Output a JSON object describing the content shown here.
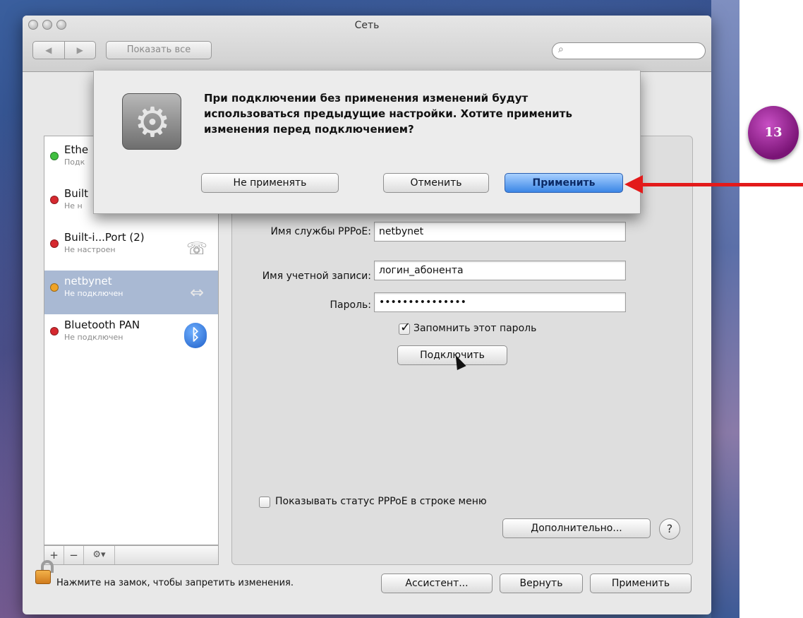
{
  "window": {
    "title": "Сеть",
    "nav": {
      "back_glyph": "◀",
      "forward_glyph": "▶"
    },
    "show_all_label": "Показать все",
    "search": {
      "icon": "magnifier-icon",
      "glyph": "⌕",
      "placeholder": ""
    }
  },
  "sidebar": {
    "items": [
      {
        "name": "Ethe",
        "status": "Подк",
        "dot_color": "#3fbf3f",
        "icon": "ethernet-icon",
        "selected": false
      },
      {
        "name": "Built",
        "status": "Не н",
        "dot_color": "#d6282f",
        "icon": "modem-icon",
        "selected": false
      },
      {
        "name": "Built-i...Port (2)",
        "status": "Не настроен",
        "dot_color": "#d6282f",
        "icon": "phone-icon",
        "selected": false
      },
      {
        "name": "netbynet",
        "status": "Не подключен",
        "dot_color": "#f0a326",
        "icon": "pppoe-arrows-icon",
        "selected": true
      },
      {
        "name": "Bluetooth PAN",
        "status": "Не подключен",
        "dot_color": "#d6282f",
        "icon": "bluetooth-icon",
        "selected": false
      }
    ],
    "add_label": "+",
    "remove_label": "−",
    "gear_label": "⚙▾"
  },
  "form": {
    "service_label": "Имя службы PPPoE:",
    "service_value": "netbynet",
    "account_label": "Имя учетной записи:",
    "account_value": "логин_абонента",
    "password_label": "Пароль:",
    "password_value": "•••••••••••••••",
    "remember_label": "Запомнить этот пароль",
    "remember_checked": true,
    "connect_label": "Подключить",
    "show_status_label": "Показывать статус PPPoE в строке меню",
    "show_status_checked": false,
    "advanced_label": "Дополнительно...",
    "help_label": "?"
  },
  "footer": {
    "lock_text": "Нажмите на замок, чтобы запретить изменения.",
    "assistant_label": "Ассистент...",
    "revert_label": "Вернуть",
    "apply_label": "Применить"
  },
  "sheet": {
    "message": "При подключении без применения изменений будут использоваться предыдущие настройки. Хотите применить изменения перед подключением?",
    "dont_apply_label": "Не применять",
    "cancel_label": "Отменить",
    "apply_label": "Применить"
  },
  "annotation": {
    "badge_number": "13",
    "arrow_color": "#e31a1a"
  }
}
